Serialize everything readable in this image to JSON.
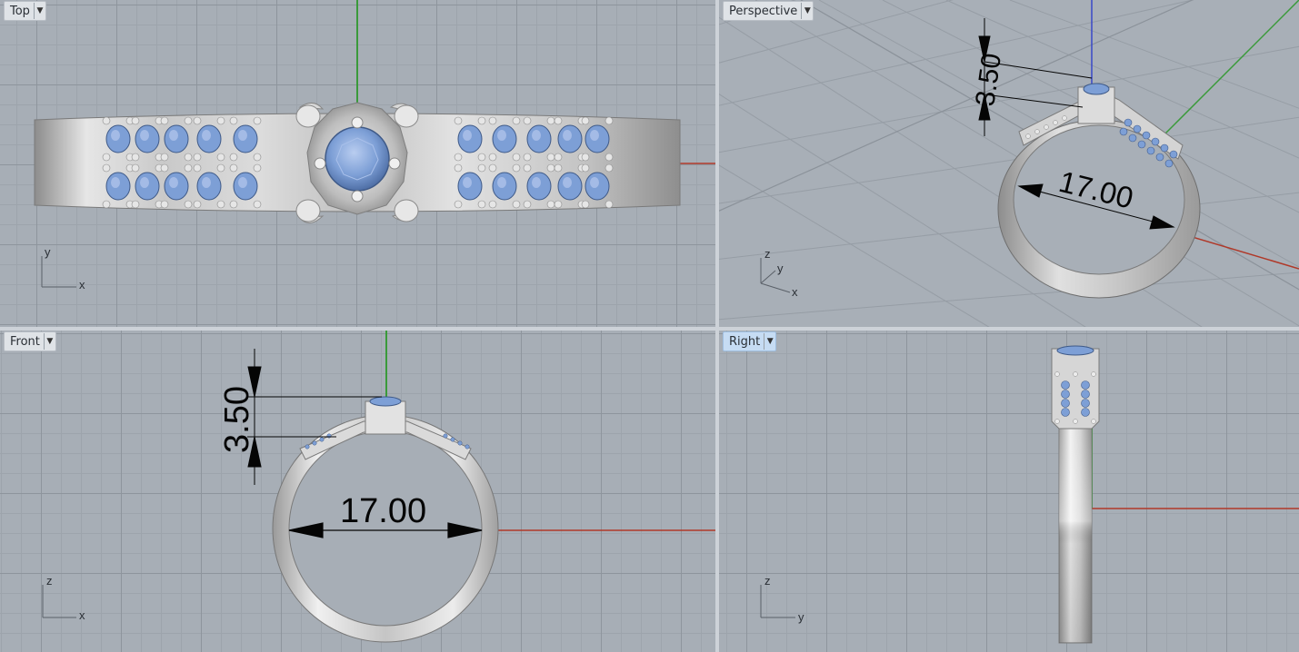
{
  "viewports": {
    "top": {
      "label": "Top",
      "axis_h": "x",
      "axis_v": "y",
      "active": false
    },
    "persp": {
      "label": "Perspective",
      "axis_x": "x",
      "axis_y": "y",
      "axis_z": "z",
      "active": false
    },
    "front": {
      "label": "Front",
      "axis_h": "x",
      "axis_v": "z",
      "active": false
    },
    "right": {
      "label": "Right",
      "axis_h": "y",
      "axis_v": "z",
      "active": true
    }
  },
  "dimensions": {
    "ring_diameter": "17.00",
    "setting_height": "3.50"
  },
  "colors": {
    "x_axis": "#b03828",
    "y_axis": "#3a9a3a",
    "z_axis": "#3848c8",
    "metal": "#d6d6d6",
    "gem": "#7d9fd6"
  },
  "icons": {
    "tab_menu": "dropdown-arrow-icon"
  }
}
